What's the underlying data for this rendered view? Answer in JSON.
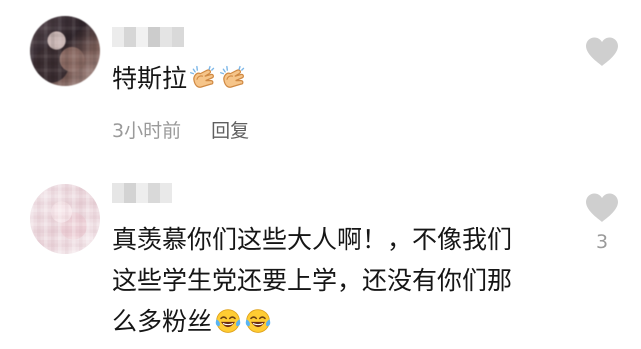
{
  "comments": [
    {
      "text_lines": [
        "特斯拉"
      ],
      "time": "3小时前",
      "reply_label": "回复"
    },
    {
      "text_lines": [
        "真羡慕你们这些大人啊！，不像我们",
        "这些学生党还要上学，还没有你们那",
        "么多粉丝"
      ],
      "like_count": "3"
    }
  ],
  "icons": {
    "like": "heart-icon",
    "clap": "clapping-hands-emoji",
    "laugh": "tears-of-joy-emoji"
  },
  "colors": {
    "text": "#161616",
    "meta": "#9a9a9a",
    "reply": "#5f5f5f",
    "heart": "#cfcfcf"
  }
}
